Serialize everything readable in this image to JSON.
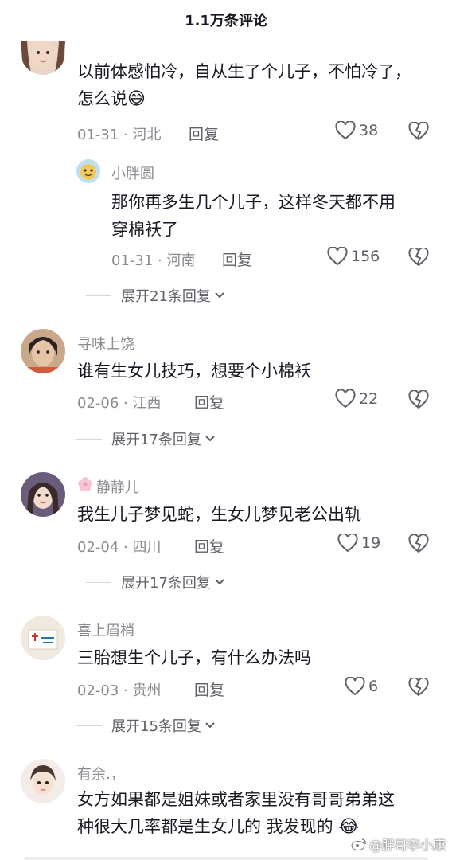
{
  "header": {
    "title": "1.1万条评论"
  },
  "comments": [
    {
      "nick": "",
      "text_lines": [
        "以前体感怕冷，自从生了个儿子，不怕冷了，",
        "怎么说"
      ],
      "emoji": "😅",
      "date": "01-31",
      "location": "河北",
      "reply_label": "回复",
      "likes": "38"
    },
    {
      "nick": "寻味上饶",
      "text_lines": [
        "谁有生女儿技巧，想要个小棉袄"
      ],
      "date": "02-06",
      "location": "江西",
      "reply_label": "回复",
      "likes": "22",
      "expand": "展开17条回复"
    },
    {
      "nick": "静静儿",
      "text_lines": [
        "我生儿子梦见蛇，生女儿梦见老公出轨"
      ],
      "date": "02-04",
      "location": "四川",
      "reply_label": "回复",
      "likes": "19",
      "expand": "展开17条回复"
    },
    {
      "nick": "喜上眉梢",
      "text_lines": [
        "三胎想生个儿子，有什么办法吗"
      ],
      "date": "02-03",
      "location": "贵州",
      "reply_label": "回复",
      "likes": "6",
      "expand": "展开15条回复"
    },
    {
      "nick": "有余.，",
      "text_lines": [
        "女方如果都是姐妹或者家里没有哥哥弟弟这",
        "种很大几率都是生女儿的 我发现的"
      ],
      "emoji": "😂"
    }
  ],
  "reply": {
    "nick": "小胖圆",
    "text_lines": [
      "那你再多生几个儿子，这样冬天都不用",
      "穿棉袄了"
    ],
    "date": "01-31",
    "location": "河南",
    "reply_label": "回复",
    "likes": "156",
    "expand": "展开21条回复"
  },
  "watermark": "@胖哥李小康",
  "icons": {
    "like": "heart-outline-icon",
    "dislike": "broken-heart-icon",
    "chevron": "chevron-down-icon",
    "weibo": "weibo-icon"
  },
  "colors": {
    "primary_text": "#161823",
    "secondary_text": "#8a8b91"
  }
}
